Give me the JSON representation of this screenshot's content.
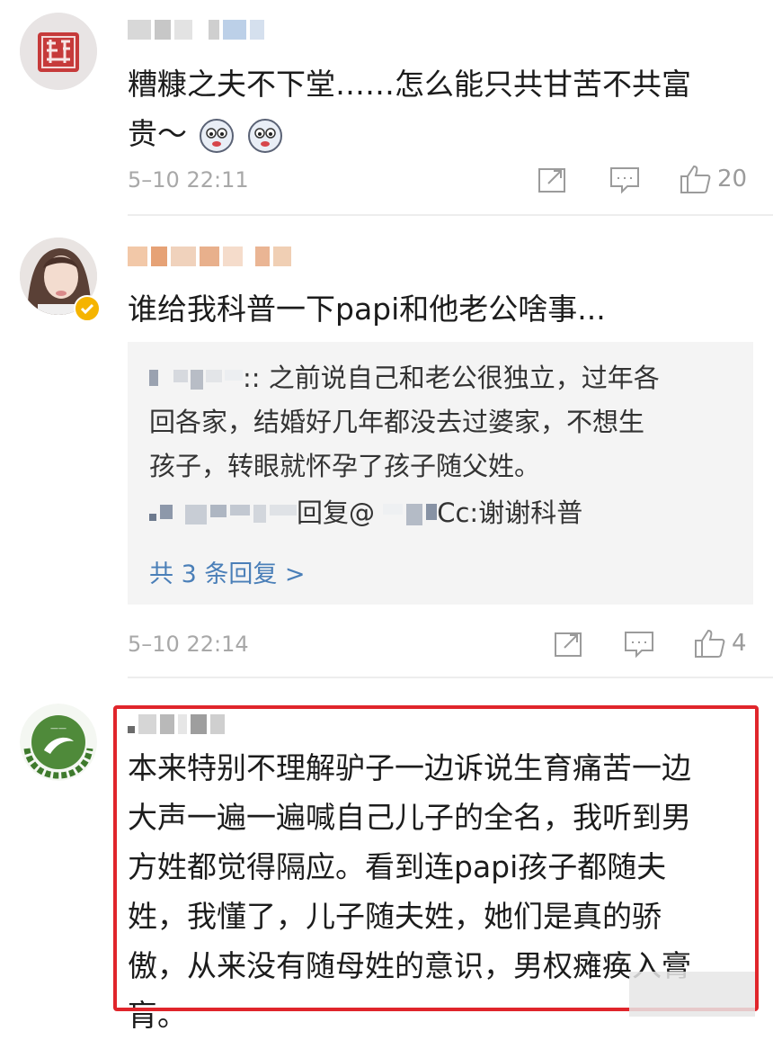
{
  "comments": [
    {
      "text_line1": "糟糠之夫不下堂……怎么能只共甘苦不共富",
      "text_line2": "贵～",
      "timestamp": "5–10 22:11",
      "likes": "20"
    },
    {
      "text_line1": "谁给我科普一下papi和他老公啥事...",
      "reply_line1_suffix": ":: 之前说自己和老公很独立，过年各",
      "reply_line2": "回各家，结婚好几年都没去过婆家，不想生",
      "reply_line3": "孩子，转眼就怀孕了孩子随父姓。",
      "reply2_mid": "回复@",
      "reply2_end": "Cc:谢谢科普",
      "more_replies": "共 3 条回复 >",
      "timestamp": "5–10 22:14",
      "likes": "4"
    },
    {
      "lines": [
        "本来特别不理解驴子一边诉说生育痛苦一边",
        "大声一遍一遍喊自己儿子的全名，我听到男",
        "方姓都觉得隔应。看到连papi孩子都随夫",
        "姓，我懂了，儿子随夫姓，她们是真的骄",
        "傲，从来没有随母姓的意识，男权瘫痪入膏",
        "肓。"
      ]
    }
  ],
  "icons": {
    "share": "share-icon",
    "comment": "comment-icon",
    "like": "thumbs-up-icon",
    "verified": "verified-badge-icon"
  },
  "colors": {
    "highlight_border": "#e0252b",
    "link": "#4a7fb8",
    "meta": "#a8a8a8"
  }
}
